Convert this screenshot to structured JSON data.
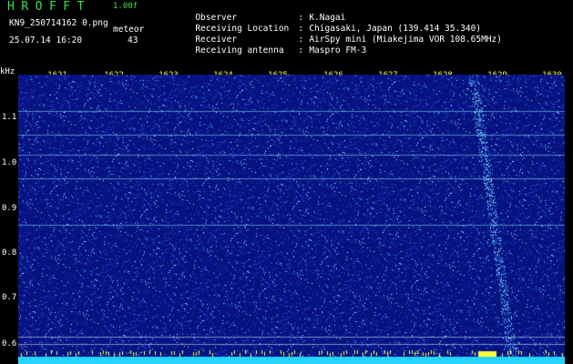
{
  "header": {
    "app_title": "HROFFT",
    "app_version": "1.00f",
    "file_name": "KN9_250714162 0.png",
    "datetime": "25.07.14 16:20",
    "meteor_label": "meteor",
    "meteor_count": "43",
    "info": [
      {
        "key": "Observer",
        "value": "K.Nagai"
      },
      {
        "key": "Receiving Location",
        "value": "Chigasaki, Japan (139.414 35.340)"
      },
      {
        "key": "Receiver",
        "value": "AirSpy mini (Miakejima VOR 108.65MHz)"
      },
      {
        "key": "Receiving antenna",
        "value": "Maspro FM-3"
      }
    ],
    "separator": ":"
  },
  "freq_axis": {
    "ticks": [
      "1621",
      "1622",
      "1623",
      "1624",
      "1625",
      "1626",
      "1627",
      "1628",
      "1629",
      "1630"
    ]
  },
  "y_axis": {
    "unit": "kHz",
    "ticks": [
      "1.1",
      "1.0",
      "0.9",
      "0.8",
      "0.7",
      "0.6"
    ]
  },
  "colors": {
    "background": "#000000",
    "waterfall_base": "#0a1a7a",
    "signal_line": "#8fe3ff",
    "baseline_strip": "#27d4ff",
    "label_yellow": "#ffff3a",
    "title_green": "#3be04a"
  },
  "meteor_trail_freq": "1629"
}
